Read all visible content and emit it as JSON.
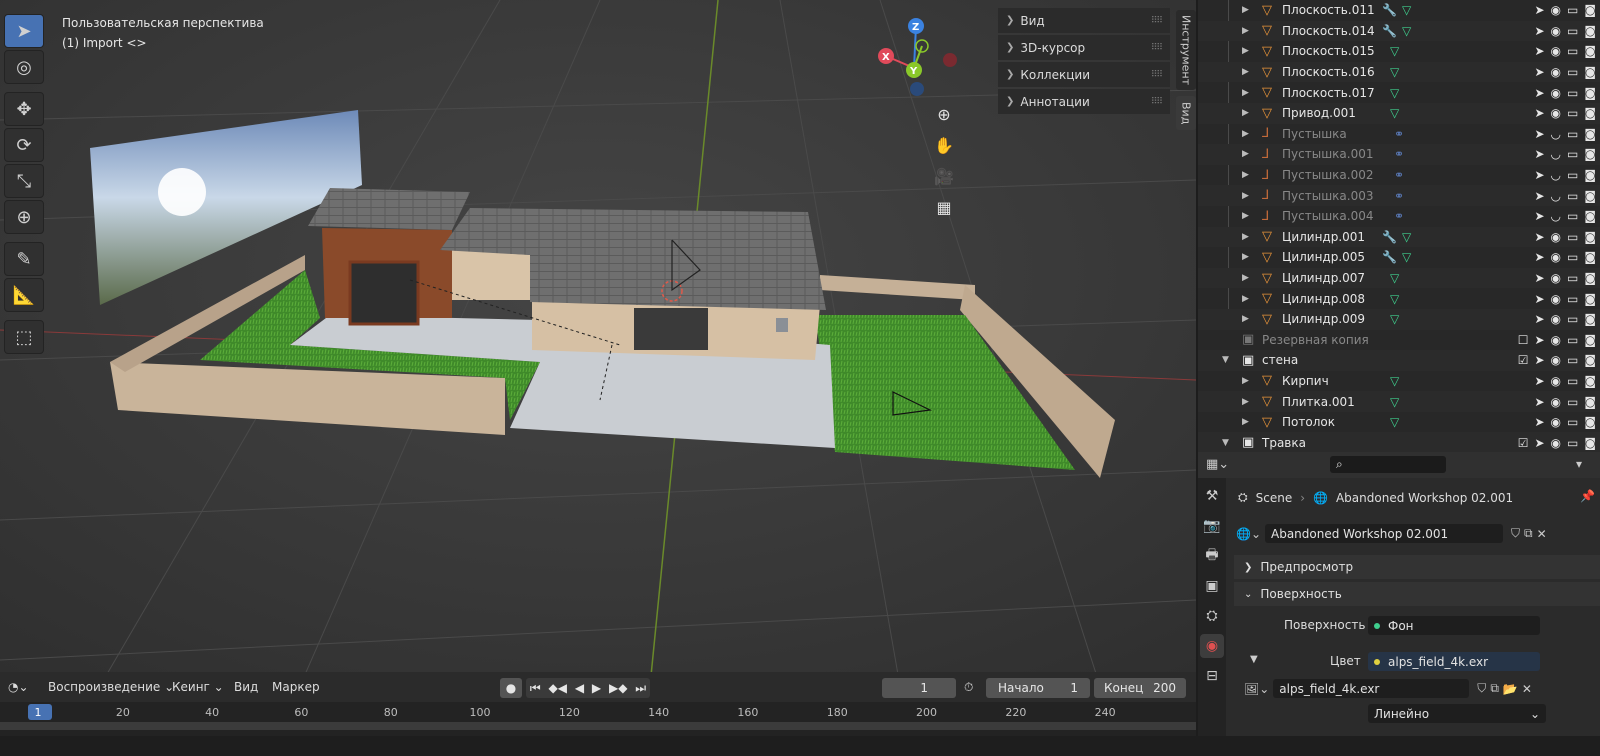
{
  "viewport": {
    "perspective_label": "Пользовательская перспектива",
    "collection_label": "(1) Import <>",
    "npanel": [
      "Вид",
      "3D-курсор",
      "Коллекции",
      "Аннотации"
    ],
    "side_tabs": [
      "Инструмент",
      "Вид"
    ],
    "gizmo": {
      "z": "Z",
      "x": "X",
      "y": "Y"
    }
  },
  "outliner": {
    "rows": [
      {
        "name": "Плоскость.011",
        "type": "mesh",
        "mods": "wrench+mesh",
        "dim": false
      },
      {
        "name": "Плоскость.014",
        "type": "mesh",
        "mods": "wrench+mesh",
        "dim": false
      },
      {
        "name": "Плоскость.015",
        "type": "mesh",
        "mods": "mesh",
        "dim": false
      },
      {
        "name": "Плоскость.016",
        "type": "mesh",
        "mods": "mesh",
        "dim": false
      },
      {
        "name": "Плоскость.017",
        "type": "mesh",
        "mods": "mesh",
        "dim": false
      },
      {
        "name": "Привод.001",
        "type": "mesh",
        "mods": "mesh",
        "dim": false
      },
      {
        "name": "Пустышка",
        "type": "empty",
        "mods": "link",
        "dim": true
      },
      {
        "name": "Пустышка.001",
        "type": "empty",
        "mods": "link",
        "dim": true
      },
      {
        "name": "Пустышка.002",
        "type": "empty",
        "mods": "link",
        "dim": true
      },
      {
        "name": "Пустышка.003",
        "type": "empty",
        "mods": "link",
        "dim": true
      },
      {
        "name": "Пустышка.004",
        "type": "empty",
        "mods": "link",
        "dim": true
      },
      {
        "name": "Цилиндр.001",
        "type": "mesh",
        "mods": "wrench+mesh",
        "dim": false
      },
      {
        "name": "Цилиндр.005",
        "type": "mesh",
        "mods": "wrench+mesh",
        "dim": false
      },
      {
        "name": "Цилиндр.007",
        "type": "mesh",
        "mods": "mesh",
        "dim": false
      },
      {
        "name": "Цилиндр.008",
        "type": "mesh",
        "mods": "mesh",
        "dim": false
      },
      {
        "name": "Цилиндр.009",
        "type": "mesh",
        "mods": "mesh",
        "dim": false
      },
      {
        "name": "Резервная копия",
        "type": "collection",
        "mods": "",
        "dim": true
      },
      {
        "name": "стена",
        "type": "collection",
        "mods": "",
        "dim": false
      },
      {
        "name": "Кирпич",
        "type": "mesh",
        "mods": "mesh",
        "dim": false
      },
      {
        "name": "Плитка.001",
        "type": "mesh",
        "mods": "mesh",
        "dim": false
      },
      {
        "name": "Потолок",
        "type": "mesh",
        "mods": "mesh",
        "dim": false
      },
      {
        "name": "Травка",
        "type": "collection",
        "mods": "",
        "dim": false
      }
    ]
  },
  "properties": {
    "breadcrumb_scene": "Scene",
    "breadcrumb_world": "Abandoned Workshop 02.001",
    "world_name": "Abandoned Workshop 02.001",
    "section_preview": "Предпросмотр",
    "section_surface": "Поверхность",
    "surface_label": "Поверхность",
    "surface_value": "Фон",
    "color_label": "Цвет",
    "color_value": "alps_field_4k.exr",
    "image_name": "alps_field_4k.exr",
    "interpolation": "Линейно"
  },
  "timeline": {
    "playback": "Воспроизведение",
    "keying": "Кеинг",
    "view": "Вид",
    "marker": "Маркер",
    "current_frame": "1",
    "start_label": "Начало",
    "start_value": "1",
    "end_label": "Конец",
    "end_value": "200",
    "ruler": [
      "1",
      "20",
      "40",
      "60",
      "80",
      "100",
      "120",
      "140",
      "160",
      "180",
      "200",
      "220",
      "240"
    ]
  },
  "colors": {
    "accent": "#4772b3",
    "mesh_icon": "#e8943a",
    "modifier": "#4aa3e0",
    "mesh_data": "#3fcf8e"
  }
}
